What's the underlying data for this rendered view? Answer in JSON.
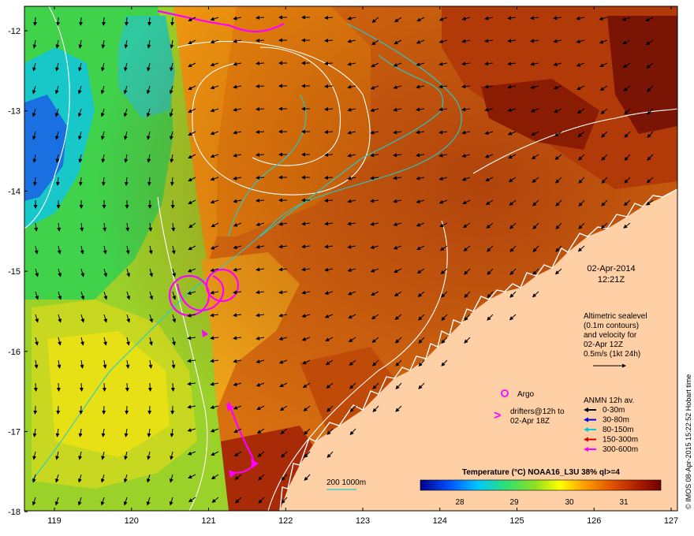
{
  "map": {
    "date": "02-Apr-2014",
    "time": "12:21Z",
    "altimetry_text": [
      "Altimetric sealevel",
      "(0.1m contours)",
      "and velocity for",
      "02-Apr 12Z",
      "0.5m/s (1kt 24h)"
    ],
    "argo_label": "Argo",
    "drifters_text": [
      "drifters@12h to",
      "02-Apr 18Z"
    ],
    "anmn_title": "ANMN 12h av.",
    "anmn_items": [
      {
        "label": "0-30m",
        "color": "#000000"
      },
      {
        "label": "30-80m",
        "color": "#0000dd"
      },
      {
        "label": "80-150m",
        "color": "#00cccc"
      },
      {
        "label": "150-300m",
        "color": "#dd0000"
      },
      {
        "label": "300-600m",
        "color": "#ff00ff"
      }
    ],
    "isobath_label": "200  1000m",
    "colorbar_title": "Temperature (°C) NOAA16_L3U 38% ql>=4",
    "colorbar_ticks": [
      "28",
      "29",
      "30",
      "31"
    ],
    "credit": "© IMOS 08-Apr-2015 15:22:52 Hobart time",
    "x_ticks": [
      "119",
      "120",
      "121",
      "122",
      "123",
      "124",
      "125",
      "126",
      "127"
    ],
    "y_ticks": [
      "-12",
      "-13",
      "-14",
      "-15",
      "-16",
      "-17",
      "-18"
    ],
    "colors": {
      "land": "#ffcfa6",
      "drifter": "#ff00ff",
      "contour": "#ffffff",
      "isobath": "#22cccc"
    }
  }
}
